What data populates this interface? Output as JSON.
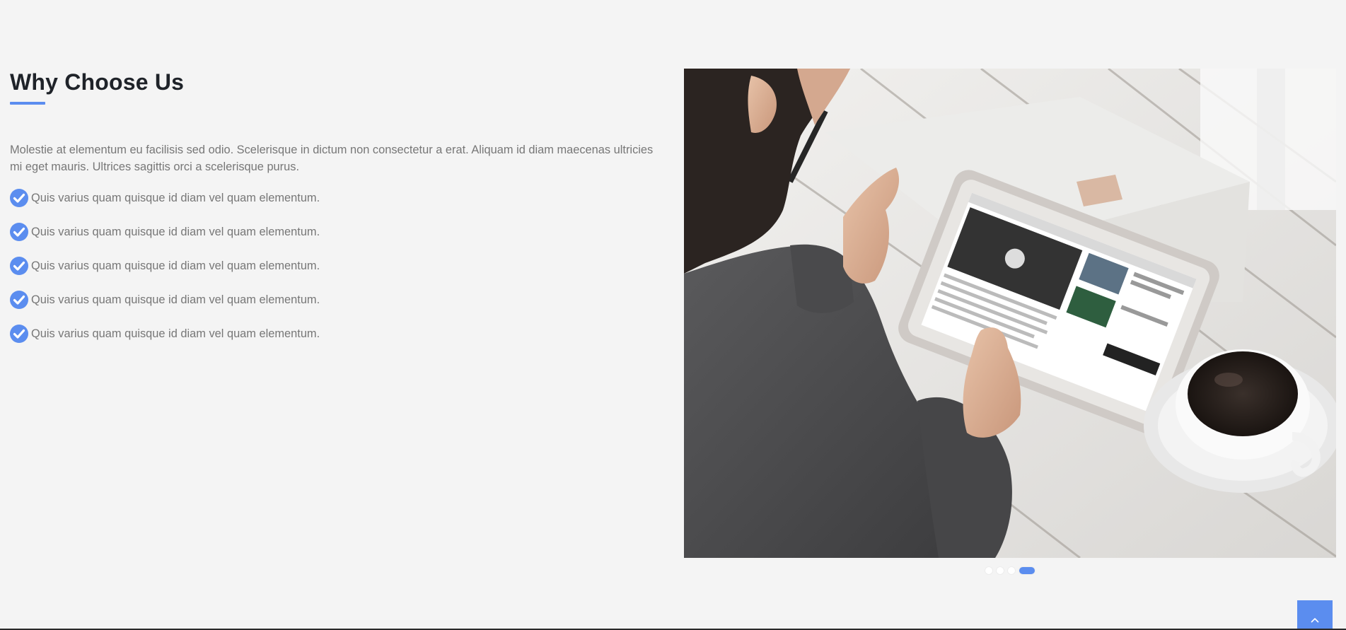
{
  "section": {
    "title": "Why Choose Us",
    "accent_color": "#5b8def",
    "intro": "Molestie at elementum eu facilisis sed odio. Scelerisque in dictum non consectetur a erat. Aliquam id diam maecenas ultricies mi eget mauris. Ultrices sagittis orci a scelerisque purus.",
    "features": [
      {
        "icon": "check-circle-icon",
        "text": "Quis varius quam quisque id diam vel quam elementum."
      },
      {
        "icon": "check-circle-icon",
        "text": "Quis varius quam quisque id diam vel quam elementum."
      },
      {
        "icon": "check-circle-icon",
        "text": "Quis varius quam quisque id diam vel quam elementum."
      },
      {
        "icon": "check-circle-icon",
        "text": "Quis varius quam quisque id diam vel quam elementum."
      },
      {
        "icon": "check-circle-icon",
        "text": "Quis varius quam quisque id diam vel quam elementum."
      }
    ]
  },
  "carousel": {
    "slide_count": 4,
    "active_index": 3,
    "image_subject": "person using a tablet next to a cup of coffee on a wooden table"
  },
  "back_to_top": {
    "icon": "chevron-up-icon"
  }
}
